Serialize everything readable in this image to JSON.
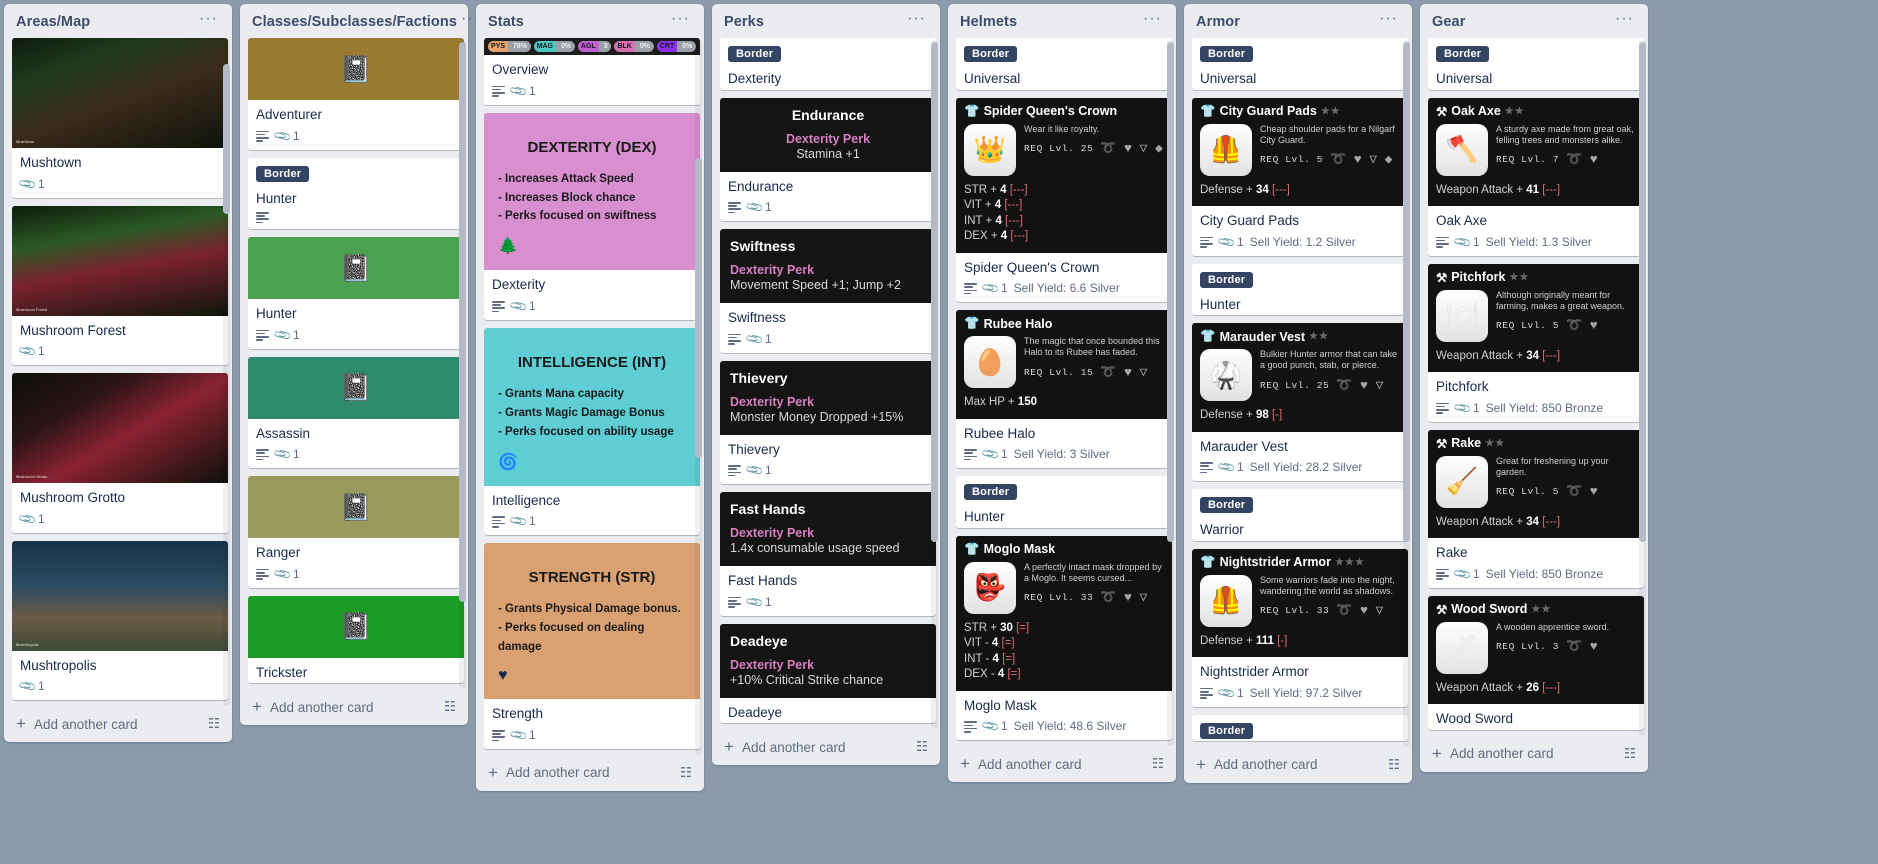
{
  "board": {
    "add_card_label": "Add another card",
    "list_menu_glyph": "···",
    "template_icon": "template-card-icon"
  },
  "lists": [
    {
      "id": "areas-map",
      "title": "Areas/Map",
      "cards": [
        {
          "kind": "photo",
          "title": "Mushtown",
          "attachments": "1",
          "watermark": "Mushtown",
          "cover": "mushtown"
        },
        {
          "kind": "photo",
          "title": "Mushroom Forest",
          "attachments": "1",
          "watermark": "Mushroom Forest",
          "cover": "forest"
        },
        {
          "kind": "photo",
          "title": "Mushroom Grotto",
          "attachments": "1",
          "watermark": "Mushroom Grotto",
          "cover": "grotto"
        },
        {
          "kind": "photo",
          "title": "Mushtropolis",
          "attachments": "1",
          "watermark": "Mushtropolis",
          "cover": "mushtropolis"
        }
      ]
    },
    {
      "id": "classes",
      "title": "Classes/Subclasses/Factions",
      "cards": [
        {
          "kind": "solid",
          "color": "#9b7b32",
          "title": "Adventurer",
          "attachments": "1",
          "desc": true
        },
        {
          "kind": "label",
          "label": "Border",
          "title": "Hunter",
          "desc": true
        },
        {
          "kind": "solid",
          "color": "#4ba352",
          "title": "Hunter",
          "attachments": "1",
          "desc": true
        },
        {
          "kind": "solid",
          "color": "#2e8b6e",
          "title": "Assassin",
          "attachments": "1",
          "desc": true
        },
        {
          "kind": "solid",
          "color": "#9a9a5c",
          "title": "Ranger",
          "attachments": "1",
          "desc": true
        },
        {
          "kind": "solid",
          "color": "#1b9c26",
          "title": "Trickster",
          "desc": false
        }
      ]
    },
    {
      "id": "stats",
      "title": "Stats",
      "strip": [
        {
          "key": "PYS",
          "value": "78%",
          "color": "#e3a269"
        },
        {
          "key": "MAG",
          "value": "0%",
          "color": "#4dc8c0"
        },
        {
          "key": "AGL",
          "value": "3",
          "color": "#c060d0"
        },
        {
          "key": "BLK",
          "value": "0%",
          "color": "#d46fb0"
        },
        {
          "key": "CRT",
          "value": "0%",
          "color": "#8b2fe8"
        }
      ],
      "cards": [
        {
          "kind": "strip",
          "title": "Overview",
          "attachments": "1",
          "desc": true
        },
        {
          "kind": "stat",
          "color": "#d88fd0",
          "heading": "DEXTERITY (DEX)",
          "lines": [
            "- Increases Attack Speed",
            "- Increases Block chance",
            "- Perks focused on swiftness"
          ],
          "emoji": "🌲",
          "title": "Dexterity",
          "attachments": "1",
          "desc": true
        },
        {
          "kind": "stat",
          "color": "#5ecdd4",
          "heading": "INTELLIGENCE (INT)",
          "lines": [
            "- Grants Mana capacity",
            "- Grants Magic Damage Bonus",
            "- Perks focused on ability usage"
          ],
          "emoji": "🌀",
          "title": "Intelligence",
          "attachments": "1",
          "desc": true
        },
        {
          "kind": "stat",
          "color": "#d9a172",
          "heading": "STRENGTH (STR)",
          "lines": [
            "- Grants Physical Damage bonus.",
            "- Perks focused on dealing damage"
          ],
          "emoji": "♥",
          "title": "Strength",
          "attachments": "1",
          "desc": true
        }
      ]
    },
    {
      "id": "perks",
      "title": "Perks",
      "cards": [
        {
          "kind": "label",
          "label": "Border",
          "title": "Dexterity"
        },
        {
          "kind": "perk",
          "center": true,
          "name": "Endurance",
          "type": "Dexterity Perk",
          "effect": "Stamina +1",
          "title": "Endurance",
          "attachments": "1",
          "desc": true
        },
        {
          "kind": "perk",
          "center": false,
          "name": "Swiftness",
          "type": "Dexterity Perk",
          "effect": "Movement Speed +1; Jump +2",
          "title": "Swiftness",
          "attachments": "1",
          "desc": true
        },
        {
          "kind": "perk",
          "center": false,
          "name": "Thievery",
          "type": "Dexterity Perk",
          "effect": "Monster Money Dropped +15%",
          "title": "Thievery",
          "attachments": "1",
          "desc": true
        },
        {
          "kind": "perk",
          "center": false,
          "name": "Fast Hands",
          "type": "Dexterity Perk",
          "effect": "1.4x consumable usage speed",
          "title": "Fast Hands",
          "attachments": "1",
          "desc": true
        },
        {
          "kind": "perk",
          "center": false,
          "name": "Deadeye",
          "type": "Dexterity Perk",
          "effect": "+10% Critical Strike chance",
          "title": "Deadeye"
        }
      ]
    },
    {
      "id": "helmets",
      "title": "Helmets",
      "cards": [
        {
          "kind": "label",
          "label": "Border",
          "title": "Universal"
        },
        {
          "kind": "item",
          "icon": "👑",
          "name": "Spider Queen's Crown",
          "stars": "",
          "flavor": "Wear it like royalty.",
          "req": "REQ Lvl. 25",
          "elements": [
            "➰",
            "♥",
            "▽",
            "◆"
          ],
          "stats": [
            {
              "label": "STR",
              "op": "+",
              "val": "4",
              "brk": "[---]"
            },
            {
              "label": "VIT",
              "op": "+",
              "val": "4",
              "brk": "[---]"
            },
            {
              "label": "INT",
              "op": "+",
              "val": "4",
              "brk": "[---]"
            },
            {
              "label": "DEX",
              "op": "+",
              "val": "4",
              "brk": "[---]"
            }
          ],
          "title": "Spider Queen's Crown",
          "attachments": "1",
          "sell": "Sell Yield: 6.6 Silver",
          "desc": true
        },
        {
          "kind": "item",
          "icon": "🥚",
          "name": "Rubee Halo",
          "stars": "",
          "flavor": "The magic that once bounded this Halo to its Rubee has faded.",
          "req": "REQ Lvl. 15",
          "elements": [
            "➰",
            "♥",
            "▽"
          ],
          "stats": [
            {
              "label": "Max HP",
              "op": "+",
              "val": "150",
              "brk": ""
            }
          ],
          "title": "Rubee Halo",
          "attachments": "1",
          "sell": "Sell Yield: 3 Silver",
          "desc": true
        },
        {
          "kind": "label",
          "label": "Border",
          "title": "Hunter"
        },
        {
          "kind": "item",
          "icon": "👺",
          "name": "Moglo Mask",
          "stars": "",
          "flavor": "A perfectly intact mask dropped by a Moglo. It seems cursed...",
          "req": "REQ Lvl. 33",
          "elements": [
            "➰",
            "♥",
            "▽"
          ],
          "stats": [
            {
              "label": "STR",
              "op": "+",
              "val": "30",
              "brk": "[=]"
            },
            {
              "label": "VIT",
              "op": "-",
              "val": "4",
              "brk": "[=]"
            },
            {
              "label": "INT",
              "op": "-",
              "val": "4",
              "brk": "[=]"
            },
            {
              "label": "DEX",
              "op": "-",
              "val": "4",
              "brk": "[=]"
            }
          ],
          "title": "Moglo Mask",
          "attachments": "1",
          "sell": "Sell Yield: 48.6 Silver",
          "desc": true
        }
      ]
    },
    {
      "id": "armor",
      "title": "Armor",
      "cards": [
        {
          "kind": "label",
          "label": "Border",
          "title": "Universal"
        },
        {
          "kind": "item",
          "icon": "🦺",
          "name": "City Guard Pads",
          "stars": "★★",
          "flavor": "Cheap shoulder pads for a Nilgarf City Guard.",
          "req": "REQ Lvl. 5",
          "elements": [
            "➰",
            "♥",
            "▽",
            "◆"
          ],
          "stats": [
            {
              "label": "Defense",
              "op": "+",
              "val": "34",
              "brk": "[---]"
            }
          ],
          "title": "City Guard Pads",
          "attachments": "1",
          "sell": "Sell Yield: 1.2 Silver",
          "desc": true
        },
        {
          "kind": "label",
          "label": "Border",
          "title": "Hunter"
        },
        {
          "kind": "item",
          "icon": "🥋",
          "name": "Marauder Vest",
          "stars": "★★",
          "flavor": "Bulkier Hunter armor that can take a good punch, stab, or pierce.",
          "req": "REQ Lvl. 25",
          "elements": [
            "➰",
            "♥",
            "▽"
          ],
          "stats": [
            {
              "label": "Defense",
              "op": "+",
              "val": "98",
              "brk": "[-]"
            }
          ],
          "title": "Marauder Vest",
          "attachments": "1",
          "sell": "Sell Yield: 28.2 Silver",
          "desc": true
        },
        {
          "kind": "label",
          "label": "Border",
          "title": "Warrior"
        },
        {
          "kind": "item",
          "icon": "🦺",
          "name": "Nightstrider Armor",
          "stars": "★★★",
          "flavor": "Some warriors fade into the night, wandering the world as shadows.",
          "req": "REQ Lvl. 33",
          "elements": [
            "➰",
            "♥",
            "▽"
          ],
          "stats": [
            {
              "label": "Defense",
              "op": "+",
              "val": "111",
              "brk": "[-]"
            }
          ],
          "title": "Nightstrider Armor",
          "attachments": "1",
          "sell": "Sell Yield: 97.2 Silver",
          "desc": true
        },
        {
          "kind": "label",
          "label": "Border",
          "title": ""
        }
      ]
    },
    {
      "id": "gear",
      "title": "Gear",
      "cards": [
        {
          "kind": "label",
          "label": "Border",
          "title": "Universal"
        },
        {
          "kind": "item",
          "icon": "🪓",
          "name": "Oak Axe",
          "stars": "★★",
          "weapon": true,
          "flavor": "A sturdy axe made from great oak, felling trees and monsters alike.",
          "req": "REQ Lvl. 7",
          "elements": [
            "➰",
            "♥"
          ],
          "stats": [
            {
              "label": "Weapon Attack",
              "op": "+",
              "val": "41",
              "brk": "[---]"
            }
          ],
          "title": "Oak Axe",
          "attachments": "1",
          "sell": "Sell Yield: 1.3 Silver",
          "desc": true
        },
        {
          "kind": "item",
          "icon": "🍽",
          "name": "Pitchfork",
          "stars": "★★",
          "weapon": true,
          "flavor": "Although originally meant for farming, makes a great weapon.",
          "req": "REQ Lvl. 5",
          "elements": [
            "➰",
            "♥"
          ],
          "stats": [
            {
              "label": "Weapon Attack",
              "op": "+",
              "val": "34",
              "brk": "[---]"
            }
          ],
          "title": "Pitchfork",
          "attachments": "1",
          "sell": "Sell Yield: 850 Bronze",
          "desc": true
        },
        {
          "kind": "item",
          "icon": "🧹",
          "name": "Rake",
          "stars": "★★",
          "weapon": true,
          "flavor": "Great for freshening up your garden.",
          "req": "REQ Lvl. 5",
          "elements": [
            "➰",
            "♥"
          ],
          "stats": [
            {
              "label": "Weapon Attack",
              "op": "+",
              "val": "34",
              "brk": "[---]"
            }
          ],
          "title": "Rake",
          "attachments": "1",
          "sell": "Sell Yield: 850 Bronze",
          "desc": true
        },
        {
          "kind": "item",
          "icon": "🗡",
          "name": "Wood Sword",
          "stars": "★★",
          "weapon": true,
          "flavor": "A wooden apprentice sword.",
          "req": "REQ Lvl. 3",
          "elements": [
            "➰",
            "♥"
          ],
          "stats": [
            {
              "label": "Weapon Attack",
              "op": "+",
              "val": "26",
              "brk": "[---]"
            }
          ],
          "title": "Wood Sword",
          "desc": false
        }
      ]
    }
  ]
}
